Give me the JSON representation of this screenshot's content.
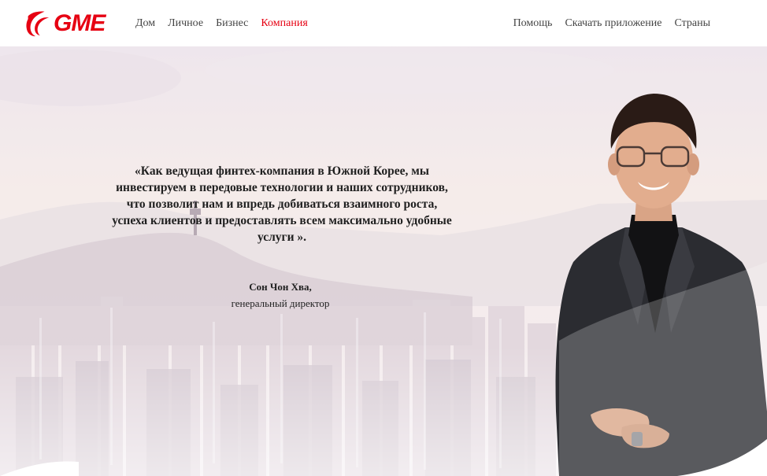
{
  "brand": {
    "name": "GME",
    "accent_color": "#e60012",
    "logo_icon": "gme-swoosh-logo-icon"
  },
  "nav": {
    "left": [
      {
        "label": "Дом",
        "active": false
      },
      {
        "label": "Личное",
        "active": false
      },
      {
        "label": "Бизнес",
        "active": false
      },
      {
        "label": "Компания",
        "active": true
      }
    ],
    "right": [
      {
        "label": "Помощь"
      },
      {
        "label": "Скачать приложение"
      },
      {
        "label": "Страны"
      }
    ]
  },
  "hero": {
    "quote_lines": [
      "«Как ведущая финтех-компания в Южной Корее, мы",
      "инвестируем в передовые технологии и наших сотрудников,",
      "что позволит нам и впредь добиваться взаимного роста,",
      "успеха клиентов и предоставлять всем максимально удобные",
      "услуги »."
    ],
    "author_name": "Сон Чон Хва,",
    "author_role": "генеральный директор",
    "background": "seoul-cityscape-image",
    "portrait": "ceo-portrait-image"
  }
}
